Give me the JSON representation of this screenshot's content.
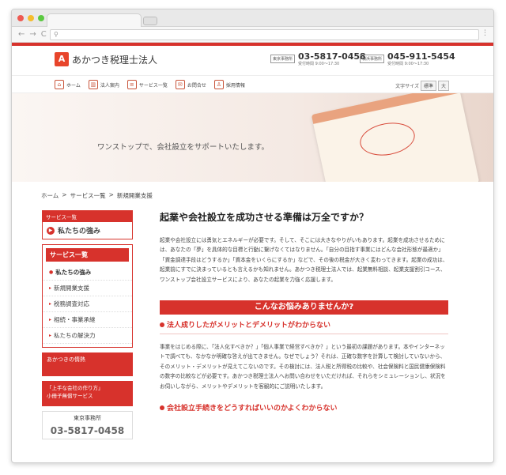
{
  "browser": {
    "url_icon": "search-icon"
  },
  "site": {
    "name": "あかつき税理士法人",
    "logo_mark": "A",
    "offices": [
      {
        "tag": "東京事務所",
        "number": "03-5817-0458",
        "hours": "受付時間 9:00〜17:30"
      },
      {
        "tag": "横浜事務所",
        "number": "045-911-5454",
        "hours": "受付時間 9:00〜17:30"
      }
    ]
  },
  "nav": {
    "items": [
      {
        "label": "ホーム",
        "icon": "home-icon"
      },
      {
        "label": "法人案内",
        "icon": "building-icon"
      },
      {
        "label": "サービス一覧",
        "icon": "list-icon"
      },
      {
        "label": "お問合せ",
        "icon": "mail-icon"
      },
      {
        "label": "採用情報",
        "icon": "person-icon"
      }
    ],
    "font_size_label": "文字サイズ",
    "font_size_options": [
      "標準",
      "大"
    ]
  },
  "hero": {
    "tagline": "ワンストップで、会社設立をサポートいたします。"
  },
  "breadcrumb": [
    "ホーム",
    ">",
    "サービス一覧",
    ">",
    "新規開業支援"
  ],
  "sidebar": {
    "services_tag": "サービス一覧",
    "strength": "私たちの強み",
    "menu_head": "サービス一覧",
    "menu_items": [
      "私たちの強み",
      "新規開業支援",
      "税務調査対応",
      "相続・事業承継",
      "私たちの解決力"
    ],
    "banner1": "あかつきの情熱",
    "banner2_line1": "「上手な会社の作り方」",
    "banner2_line2": "小冊子無償サービス",
    "office_label": "東京事務所",
    "office_number": "03-5817-0458"
  },
  "main": {
    "title": "起業や会社設立を成功させる準備は万全ですか？",
    "intro": "起業や会社設立には勇気とエネルギーが必要です。そして、そこには大きなやりがいもあります。起業を成功させるためには、あなたの「夢」を具体的な目標と行動に繋げなくてはなりません。「自分の目指す事業にはどんな会社形態が最適か」「資金調達手段はどうするか」「資本金をいくらにするか」などで、その後の税金が大きく変わってきます。起業の成功は、起業前にすでに決まっているとも言えるかも知れません。あかつき税理士法人では、起業無料相談、起業支援割引コース、ワンストップ会社設立サービスにより、あなたの起業を力強く応援します。",
    "trouble_banner": "こんなお悩みありませんか?",
    "q1_title": "法人成りしたがメリットとデメリットがわからない",
    "q1_body": "事業をはじめる際に、「法人化すべきか？」「個人事業で経営すべきか？」という最初の課題があります。本やインターネットで調べても、なかなか明確な答えが出てきません。なぜでしょう？それは、正確な数字を計算して検討していないから、そのメリット・デメリットが見えてこないのです。その検討には、法人税と所得税の比較や、社会保険料と国民健康保険料の数字の比較などが必要です。あかつき税理士法人へお問い合わせをいただければ、それらをシミュレーションし、状況をお伺いしながら、メリットやデメリットを客観的にご説明いたします。",
    "q2_title": "会社設立手続きをどうすればいいのかよくわからない"
  },
  "colors": {
    "accent": "#d7322c"
  }
}
